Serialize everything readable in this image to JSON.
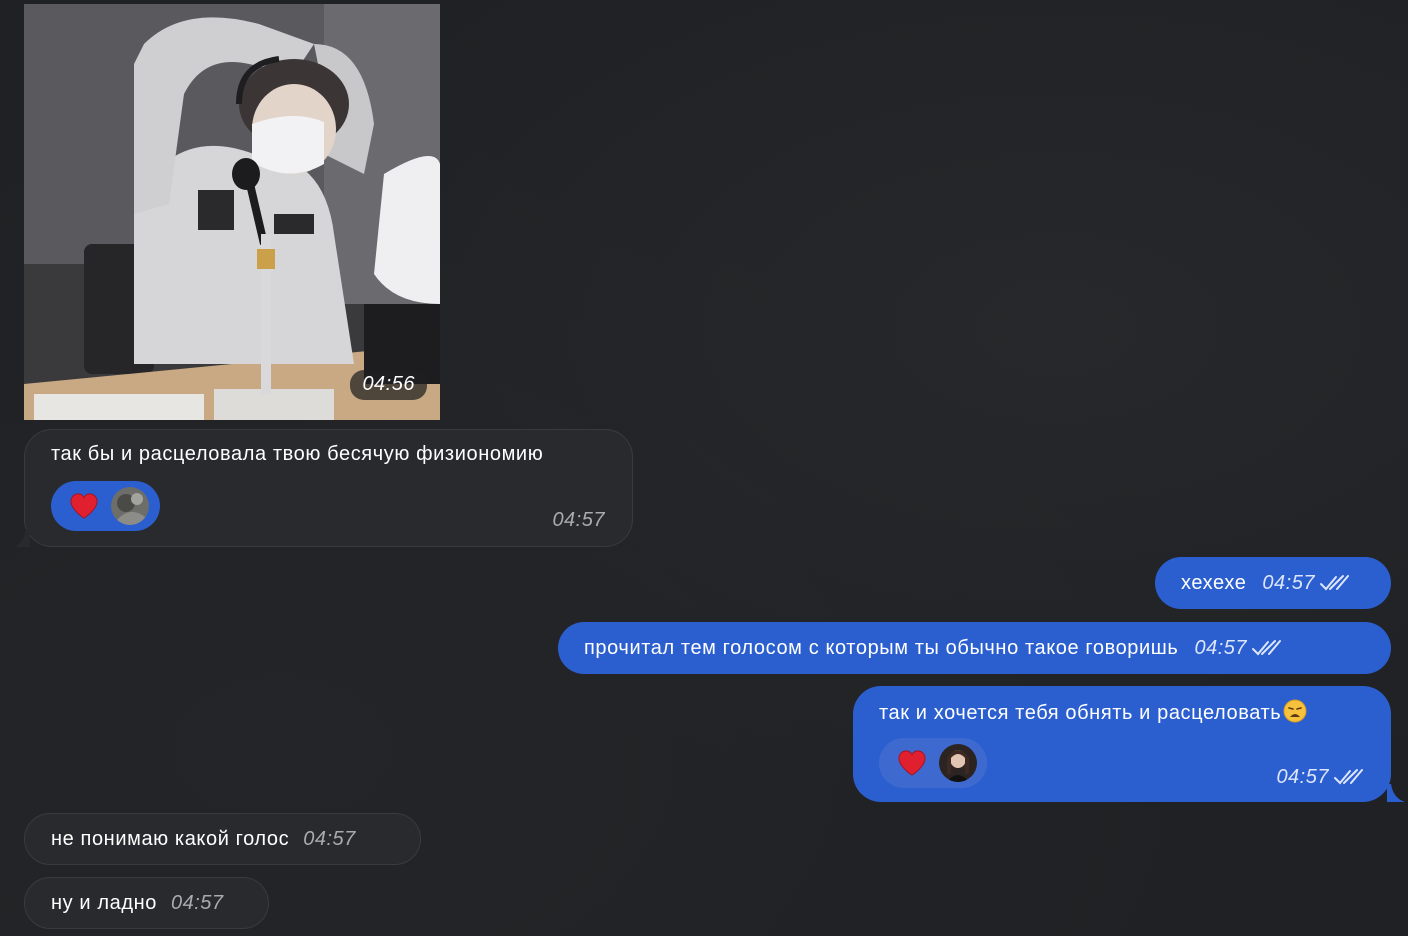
{
  "messages": [
    {
      "id": "photo",
      "type": "photo",
      "direction": "incoming",
      "time": "04:56"
    },
    {
      "id": "m1",
      "direction": "incoming",
      "text": "так бы и расцеловала твою бесячую физиономию",
      "time": "04:57",
      "reaction": "heart"
    },
    {
      "id": "m2",
      "direction": "outgoing",
      "text": "хехехе",
      "time": "04:57",
      "status": "read"
    },
    {
      "id": "m3",
      "direction": "outgoing",
      "text": "прочитал тем голосом с которым ты обычно такое говоришь",
      "time": "04:57",
      "status": "read"
    },
    {
      "id": "m4",
      "direction": "outgoing",
      "text": "так и хочется тебя обнять и расцеловать",
      "emoji": "weary-face",
      "time": "04:57",
      "status": "read",
      "reaction": "heart"
    },
    {
      "id": "m5",
      "direction": "incoming",
      "text": "не понимаю какой голос",
      "time": "04:57"
    },
    {
      "id": "m6",
      "direction": "incoming",
      "text": "ну и ладно",
      "time": "04:57"
    }
  ],
  "colors": {
    "background": "#1f2124",
    "incoming_bubble": "#292a2d",
    "outgoing_bubble": "#2b5fd0",
    "reaction_heart": "#e0202f"
  }
}
